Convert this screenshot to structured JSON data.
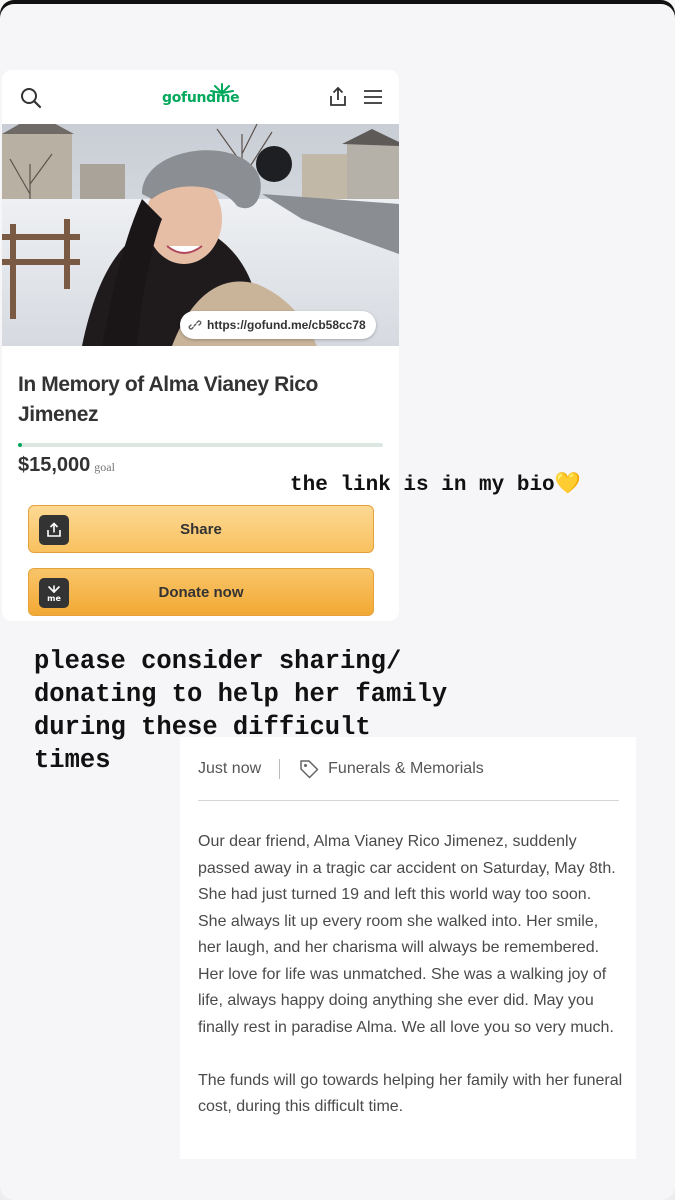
{
  "gfm": {
    "logo_text": "gofundme",
    "photo_alt": "",
    "link_url": "https://gofund.me/cb58cc78",
    "title": "In Memory of Alma Vianey Rico Jimenez",
    "progress_fraction": 0.01,
    "goal_amount": "$15,000",
    "goal_label": "goal",
    "share_label": "Share",
    "donate_label": "Donate now",
    "accent_color": "#02a95c",
    "button_color": "#f6b244"
  },
  "story": {
    "bio_caption": "the link is in my bio💛",
    "plea_lines": [
      "please consider sharing/",
      "donating to help her family",
      "during these difficult",
      "times"
    ]
  },
  "description": {
    "time_label": "Just now",
    "category": "Funerals & Memorials",
    "paragraphs": [
      "Our dear friend, Alma Vianey Rico Jimenez, suddenly passed away in a tragic car accident on Saturday, May 8th. She had just turned 19 and left this world way too soon.  She always lit up every room she walked into. Her smile, her laugh, and her charisma will always be remembered. Her love for life was unmatched. She was a walking joy of life, always happy doing anything she ever did. May you finally rest in paradise Alma. We all love you so very much.",
      "The funds will go towards helping her family with her funeral cost, during this difficult time."
    ]
  }
}
